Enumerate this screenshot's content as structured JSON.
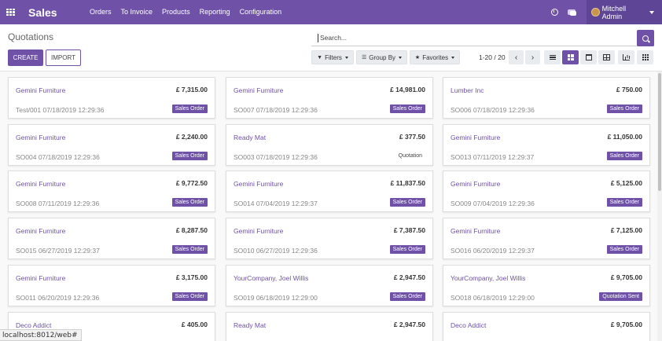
{
  "app": {
    "name": "Sales",
    "menu": [
      "Orders",
      "To Invoice",
      "Products",
      "Reporting",
      "Configuration"
    ],
    "user_name": "Mitchell Admin"
  },
  "control_panel": {
    "title": "Quotations",
    "create_label": "CREATE",
    "import_label": "IMPORT",
    "search_placeholder": "Search...",
    "filters_label": "Filters",
    "group_by_label": "Group By",
    "favorites_label": "Favorites",
    "pager": "1-20 / 20"
  },
  "colors": {
    "brand": "#6f52a8",
    "badge": "#6f52a8"
  },
  "cards": [
    {
      "customer": "Gemini Furniture",
      "amount": "£ 7,315.00",
      "meta": "Test/001 07/18/2019 12:29:36",
      "status": "Sales Order"
    },
    {
      "customer": "Gemini Furniture",
      "amount": "£ 14,981.00",
      "meta": "SO007 07/18/2019 12:29:36",
      "status": "Sales Order"
    },
    {
      "customer": "Lumber Inc",
      "amount": "£ 750.00",
      "meta": "SO006 07/18/2019 12:29:36",
      "status": "Sales Order"
    },
    {
      "customer": "Gemini Furniture",
      "amount": "£ 2,240.00",
      "meta": "SO004 07/18/2019 12:29:36",
      "status": "Sales Order"
    },
    {
      "customer": "Ready Mat",
      "amount": "£ 377.50",
      "meta": "SO003 07/18/2019 12:29:36",
      "status": "Quotation"
    },
    {
      "customer": "Gemini Furniture",
      "amount": "£ 11,050.00",
      "meta": "SO013 07/11/2019 12:29:37",
      "status": "Sales Order"
    },
    {
      "customer": "Gemini Furniture",
      "amount": "£ 9,772.50",
      "meta": "SO008 07/11/2019 12:29:36",
      "status": "Sales Order"
    },
    {
      "customer": "Gemini Furniture",
      "amount": "£ 11,837.50",
      "meta": "SO014 07/04/2019 12:29:37",
      "status": "Sales Order"
    },
    {
      "customer": "Gemini Furniture",
      "amount": "£ 5,125.00",
      "meta": "SO009 07/04/2019 12:29:36",
      "status": "Sales Order"
    },
    {
      "customer": "Gemini Furniture",
      "amount": "£ 8,287.50",
      "meta": "SO015 06/27/2019 12:29:37",
      "status": "Sales Order"
    },
    {
      "customer": "Gemini Furniture",
      "amount": "£ 7,387.50",
      "meta": "SO010 06/27/2019 12:29:36",
      "status": "Sales Order"
    },
    {
      "customer": "Gemini Furniture",
      "amount": "£ 7,125.00",
      "meta": "SO016 06/20/2019 12:29:37",
      "status": "Sales Order"
    },
    {
      "customer": "Gemini Furniture",
      "amount": "£ 3,175.00",
      "meta": "SO011 06/20/2019 12:29:36",
      "status": "Sales Order"
    },
    {
      "customer": "YourCompany, Joel Willis",
      "amount": "£ 2,947.50",
      "meta": "SO019 06/18/2019 12:29:00",
      "status": "Sales Order"
    },
    {
      "customer": "YourCompany, Joel Willis",
      "amount": "£ 9,705.00",
      "meta": "SO018 06/18/2019 12:29:00",
      "status": "Quotation Sent"
    },
    {
      "customer": "Deco Addict",
      "amount": "£ 405.00",
      "meta": "",
      "status": ""
    },
    {
      "customer": "Ready Mat",
      "amount": "£ 2,947.50",
      "meta": "",
      "status": ""
    },
    {
      "customer": "Deco Addict",
      "amount": "£ 9,705.00",
      "meta": "",
      "status": ""
    }
  ],
  "status_url": "localhost:8012/web#"
}
